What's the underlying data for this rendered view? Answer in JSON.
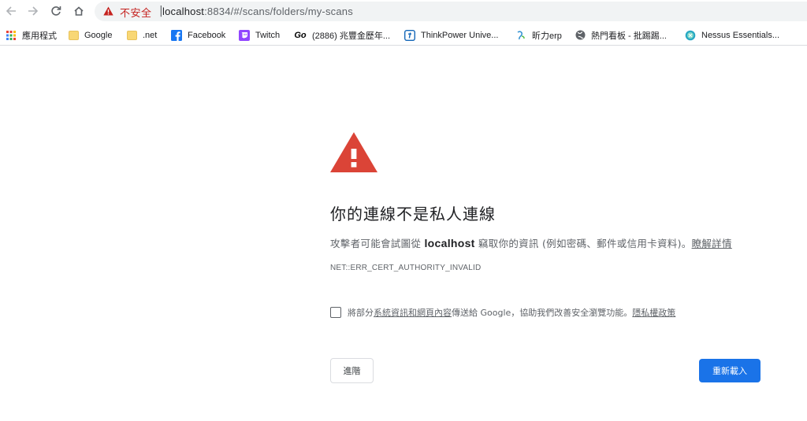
{
  "toolbar": {
    "insecure_label": "不安全",
    "separator": "|",
    "url_host": "localhost",
    "url_rest": ":8834/#/scans/folders/my-scans"
  },
  "bookmarks": [
    {
      "label": "應用程式",
      "icon": "apps-grid-icon"
    },
    {
      "label": "Google",
      "icon": "folder-icon"
    },
    {
      "label": ".net",
      "icon": "folder-icon"
    },
    {
      "label": "Facebook",
      "icon": "facebook-icon"
    },
    {
      "label": "Twitch",
      "icon": "twitch-icon"
    },
    {
      "label": "(2886) 兆豐金歷年...",
      "icon": "go-icon",
      "icon_text": "Go"
    },
    {
      "label": "ThinkPower Unive...",
      "icon": "thinkpower-icon"
    },
    {
      "label": "昕力erp",
      "icon": "erp-icon"
    },
    {
      "label": "熱門看板 - 批踢踢...",
      "icon": "globe-icon"
    },
    {
      "label": "Nessus Essentials...",
      "icon": "nessus-icon"
    }
  ],
  "error": {
    "heading": "你的連線不是私人連線",
    "explain_before": "攻擊者可能會試圖從",
    "explain_host": "localhost",
    "explain_after": "竊取你的資訊 (例如密碼、郵件或信用卡資料)。",
    "details_link": "瞭解詳情",
    "error_code": "NET::ERR_CERT_AUTHORITY_INVALID",
    "optin_before": "將部分",
    "optin_link": "系統資訊和網頁內容",
    "optin_middle": "傳送給 Google，協助我們改善安全瀏覽功能。",
    "privacy_link": "隱私權政策",
    "advanced_button": "進階",
    "reload_button": "重新載入"
  },
  "colors": {
    "warning_red": "#db4437",
    "primary_blue": "#1a73e8",
    "insecure_red": "#c5221f"
  }
}
